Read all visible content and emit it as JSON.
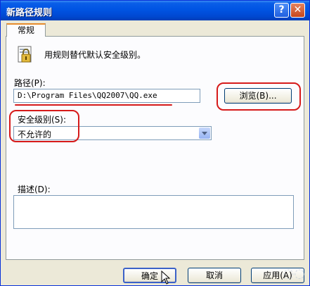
{
  "window": {
    "title": "新路径规则"
  },
  "title_buttons": {
    "help": "?",
    "close": "✕"
  },
  "tabs": [
    {
      "label": "常规"
    }
  ],
  "general": {
    "description": "用规则替代默认安全级别。",
    "path_label": "路径(P):",
    "path_value": "D:\\Program Files\\QQ2007\\QQ.exe",
    "browse_label": "浏览(B)...",
    "security_label": "安全级别(S):",
    "security_value": "不允许的",
    "describe_label": "描述(D):"
  },
  "buttons": {
    "ok": "确定",
    "cancel": "取消",
    "apply": "应用(A)"
  },
  "colors": {
    "annotation": "#d61a1a",
    "titlebar": "#0054e3",
    "dialog_bg": "#ece9d8"
  }
}
